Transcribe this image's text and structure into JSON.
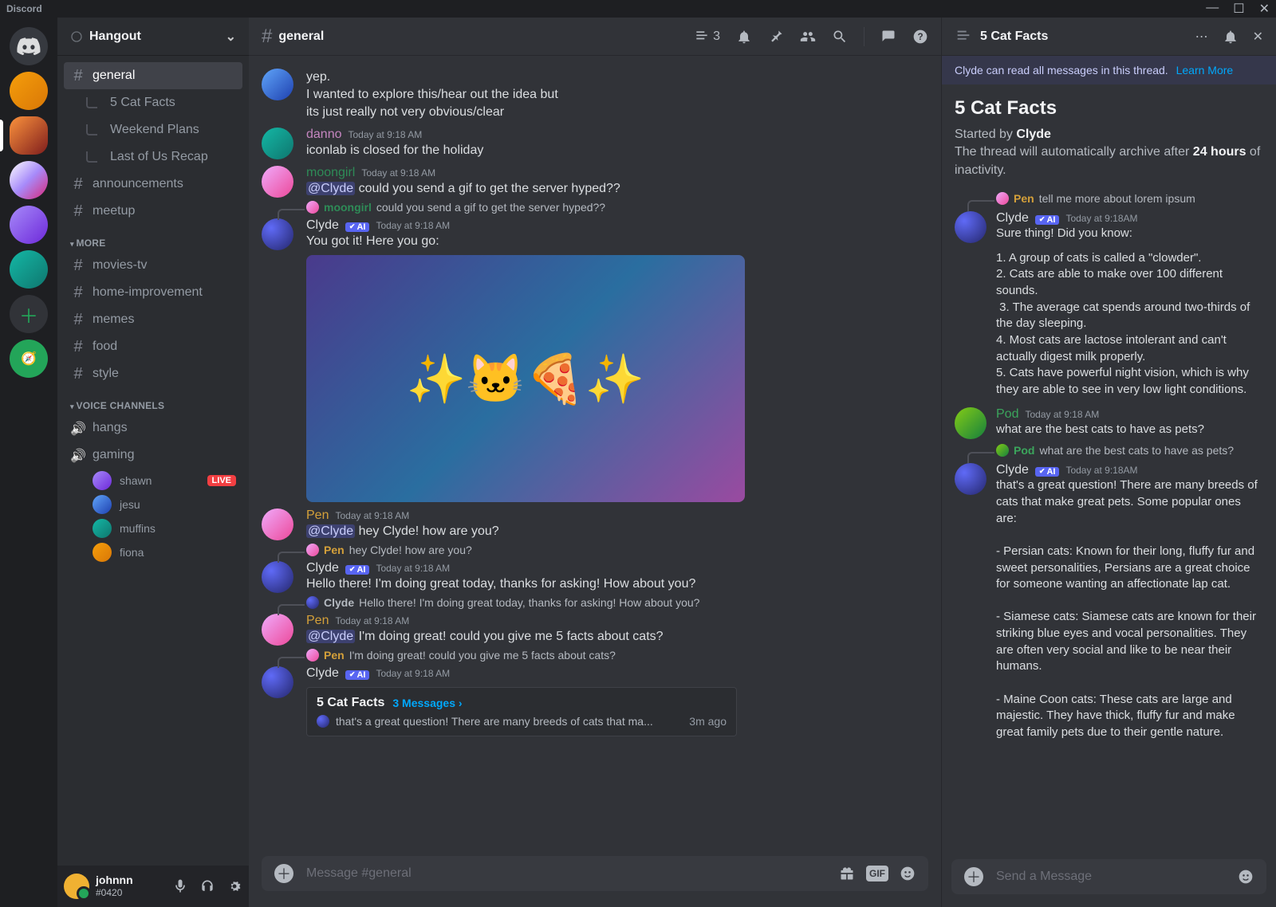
{
  "titlebar": {
    "brand": "Discord"
  },
  "server_header": {
    "name": "Hangout"
  },
  "channels": {
    "general": "general",
    "threads": [
      "5 Cat Facts",
      "Weekend Plans",
      "Last of Us Recap"
    ],
    "announcements": "announcements",
    "meetup": "meetup",
    "more_header": "MORE",
    "more": [
      "movies-tv",
      "home-improvement",
      "memes",
      "food",
      "style"
    ],
    "voice_header": "VOICE CHANNELS",
    "voice": [
      "hangs",
      "gaming"
    ],
    "voice_members": [
      "shawn",
      "jesu",
      "muffins",
      "fiona"
    ],
    "live_badge": "LIVE"
  },
  "user_bar": {
    "name": "johnnn",
    "tag": "#0420"
  },
  "chat_header": {
    "channel": "general",
    "thread_count": "3"
  },
  "messages": {
    "m0a": "yep.",
    "m0b": "I wanted to explore this/hear out the idea but",
    "m0c": "its just really not very obvious/clear",
    "danno": {
      "name": "danno",
      "time": "Today at 9:18 AM",
      "text": "iconlab is closed for the holiday",
      "color": "#c586c0"
    },
    "moongirl": {
      "name": "moongirl",
      "time": "Today at 9:18 AM",
      "mention": "@Clyde",
      "text": " could you send a gif to get the server hyped??",
      "color": "#2e8b57"
    },
    "clyde1": {
      "name": "Clyde",
      "time": "Today at 9:18 AM",
      "text": "You got it! Here you go:",
      "reply_name": "moongirl",
      "reply_text": "could you send a gif to get the server hyped??"
    },
    "pen1": {
      "name": "Pen",
      "time": "Today at 9:18 AM",
      "mention": "@Clyde",
      "text": " hey Clyde! how are you?",
      "color": "#d4a03a"
    },
    "clyde2": {
      "name": "Clyde",
      "time": "Today at 9:18 AM",
      "text": "Hello there! I'm doing great today, thanks for asking! How about you?",
      "reply_name": "Pen",
      "reply_text": "hey Clyde! how are you?"
    },
    "pen2": {
      "name": "Pen",
      "time": "Today at 9:18 AM",
      "mention": "@Clyde",
      "text": " I'm doing great! could you give me 5 facts about cats?",
      "reply_name": "Clyde",
      "reply_text": "Hello there! I'm doing great today, thanks for asking! How about you?"
    },
    "clyde3": {
      "name": "Clyde",
      "time": "Today at 9:18 AM",
      "reply_name": "Pen",
      "reply_text": "I'm doing great! could you give me 5 facts about cats?"
    },
    "thread_card": {
      "title": "5 Cat Facts",
      "count": "3 Messages",
      "preview": "that's a great question! There are many breeds of cats that ma...",
      "age": "3m ago"
    }
  },
  "composer": {
    "placeholder": "Message #general"
  },
  "thread": {
    "header_title": "5 Cat Facts",
    "banner": "Clyde can read all messages in this thread.",
    "banner_link": "Learn More",
    "title": "5 Cat Facts",
    "started_by_label": "Started by ",
    "started_by": "Clyde",
    "archive_pre": "The thread will automatically archive after ",
    "archive_hours": "24 hours",
    "archive_post": " of inactivity.",
    "t_pen_reply": {
      "name": "Pen",
      "text": "tell me more about lorem ipsum"
    },
    "t_clyde1": {
      "name": "Clyde",
      "time": "Today at 9:18AM",
      "text": "Sure thing! Did you know:",
      "facts": "1. A group of cats is called a \"clowder\".\n2. Cats are able to make over 100 different sounds.\n 3. The average cat spends around two-thirds of the day sleeping.\n4. Most cats are lactose intolerant and can't actually digest milk properly.\n5. Cats have powerful night vision, which is why they are able to see in very low light conditions."
    },
    "t_pod": {
      "name": "Pod",
      "time": "Today at 9:18 AM",
      "text": "what are the best cats to have as pets?"
    },
    "t_pod_reply": {
      "name": "Pod",
      "text": "what are the best cats to have as pets?"
    },
    "t_clyde2": {
      "name": "Clyde",
      "time": "Today at 9:18AM",
      "text": "that's a great question! There are many breeds of cats that make great pets. Some popular ones are:\n\n- Persian cats: Known for their long, fluffy fur and sweet personalities, Persians are a great choice for someone wanting an affectionate lap cat.\n\n- Siamese cats: Siamese cats are known for their striking blue eyes and vocal personalities. They are often very social and like to be near their humans.\n\n- Maine Coon cats: These cats are large and majestic. They have thick, fluffy fur and make great family pets due to their gentle nature."
    },
    "composer_placeholder": "Send a Message"
  }
}
